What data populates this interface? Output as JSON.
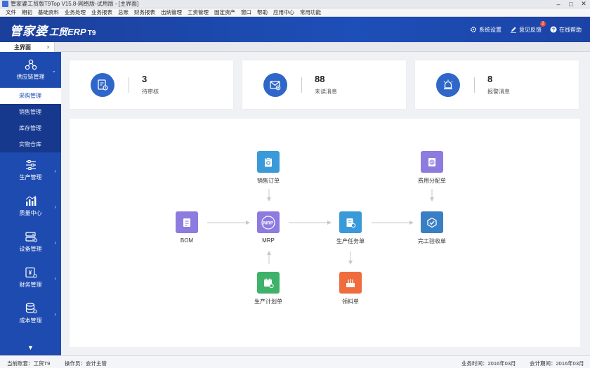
{
  "window": {
    "title": "管家婆工贸版T9Top V15.8-网络版-试用版 - [主界面]"
  },
  "menu": [
    "文件",
    "期初",
    "基础资料",
    "业务处理",
    "业务报表",
    "总账",
    "财务报表",
    "出纳管理",
    "工资管理",
    "固定资产",
    "窗口",
    "帮助",
    "应用中心",
    "常用功能"
  ],
  "header": {
    "logo_cn": "管家婆",
    "logo_en": "工贸ERP",
    "logo_ver": "T9",
    "actions": [
      {
        "label": "系统设置",
        "icon": "gear-icon"
      },
      {
        "label": "意见反馈",
        "icon": "edit-icon",
        "badge": "2"
      },
      {
        "label": "在线帮助",
        "icon": "help-icon"
      }
    ]
  },
  "tabs": [
    {
      "label": "主界面",
      "close": "×"
    }
  ],
  "sidebar": {
    "groups": [
      {
        "label": "供应链管理",
        "icon": "supply-chain-icon",
        "expanded": true,
        "items": [
          "采购管理",
          "销售管理",
          "库存管理",
          "实物仓库"
        ],
        "active": "采购管理"
      },
      {
        "label": "生产管理",
        "icon": "sliders-icon"
      },
      {
        "label": "质量中心",
        "icon": "bar-chart-icon"
      },
      {
        "label": "设备管理",
        "icon": "device-icon"
      },
      {
        "label": "财务管理",
        "icon": "finance-icon"
      },
      {
        "label": "成本管理",
        "icon": "cost-icon"
      }
    ]
  },
  "cards": [
    {
      "value": "3",
      "label": "待审核",
      "icon": "audit-icon"
    },
    {
      "value": "88",
      "label": "未读消息",
      "icon": "mail-icon"
    },
    {
      "value": "8",
      "label": "报警消息",
      "icon": "alarm-icon"
    }
  ],
  "flow": {
    "nodes": {
      "bom": {
        "label": "BOM",
        "color": "#8e7be0"
      },
      "sales_order": {
        "label": "销售订单",
        "color": "#3a9ad9"
      },
      "mrp": {
        "label": "MRP",
        "text": "MRP",
        "color": "#8e7be0"
      },
      "plan": {
        "label": "生产计划单",
        "color": "#3fb26a"
      },
      "task": {
        "label": "生产任务单",
        "color": "#3a9ad9"
      },
      "pick": {
        "label": "领料单",
        "color": "#ef6c3e"
      },
      "fee": {
        "label": "费用分配单",
        "color": "#8e7be0"
      },
      "finish": {
        "label": "完工验收单",
        "color": "#3a7fc4"
      }
    }
  },
  "status": {
    "account": "当前账套：工贸T9",
    "operator": "操作员：会计主管",
    "biz_period": "业务时间：2016年03月",
    "acct_period": "会计期间：2016年03月"
  }
}
